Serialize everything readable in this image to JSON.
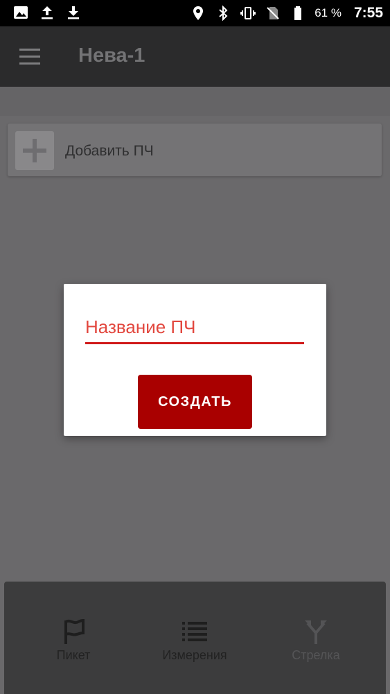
{
  "status_bar": {
    "battery_percent": "61 %",
    "time": "7:55"
  },
  "app_bar": {
    "title": "Нева-1"
  },
  "add_card": {
    "label": "Добавить ПЧ"
  },
  "dialog": {
    "input_placeholder": "Название ПЧ",
    "create_button": "СОЗДАТЬ",
    "accent_color": "#a90000"
  },
  "bottom_nav": {
    "items": [
      {
        "label": "Пикет",
        "icon": "flag-icon"
      },
      {
        "label": "Измерения",
        "icon": "list-icon"
      },
      {
        "label": "Стрелка",
        "icon": "switch-split-icon"
      }
    ]
  }
}
